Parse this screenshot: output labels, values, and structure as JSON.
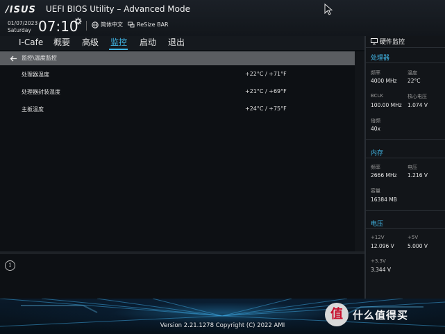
{
  "header": {
    "logo": "/ISUS",
    "title": "UEFI BIOS Utility – Advanced Mode",
    "date": "01/07/2023",
    "day": "Saturday",
    "time": "07:10",
    "language_label": "简体中文",
    "resize_bar_label": "ReSize BAR"
  },
  "menu": {
    "items": [
      {
        "label": "I-Cafe"
      },
      {
        "label": "概要"
      },
      {
        "label": "高级"
      },
      {
        "label": "监控"
      },
      {
        "label": "启动"
      },
      {
        "label": "退出"
      }
    ],
    "active": "监控"
  },
  "breadcrumb": "监控\\温度监控",
  "temperatures": [
    {
      "label": "处理器温度",
      "value": "+22°C / +71°F"
    },
    {
      "label": "处理器封装温度",
      "value": "+21°C / +69°F"
    },
    {
      "label": "主板温度",
      "value": "+24°C / +75°F"
    }
  ],
  "hardware_monitor": {
    "title": "硬件监控",
    "cpu": {
      "title": "处理器",
      "freq_label": "频率",
      "freq_value": "4000 MHz",
      "temp_label": "温度",
      "temp_value": "22°C",
      "bclk_label": "BCLK",
      "bclk_value": "100.00 MHz",
      "core_voltage_label": "核心电压",
      "core_voltage_value": "1.074 V",
      "ratio_label": "倍频",
      "ratio_value": "40x"
    },
    "memory": {
      "title": "内存",
      "freq_label": "频率",
      "freq_value": "2666 MHz",
      "voltage_label": "电压",
      "voltage_value": "1.216 V",
      "capacity_label": "容量",
      "capacity_value": "16384 MB"
    },
    "voltage": {
      "title": "电压",
      "v12_label": "+12V",
      "v12_value": "12.096 V",
      "v5_label": "+5V",
      "v5_value": "5.000 V",
      "v33_label": "+3.3V",
      "v33_value": "3.344 V"
    }
  },
  "footer": {
    "version": "Version 2.21.1278 Copyright (C) 2022 AMI"
  },
  "watermark": {
    "badge": "值",
    "text": "什么值得买"
  },
  "colors": {
    "accent": "#41b6e6",
    "background": "#0a0e12",
    "breadcrumb_bg": "#5a5d61"
  }
}
